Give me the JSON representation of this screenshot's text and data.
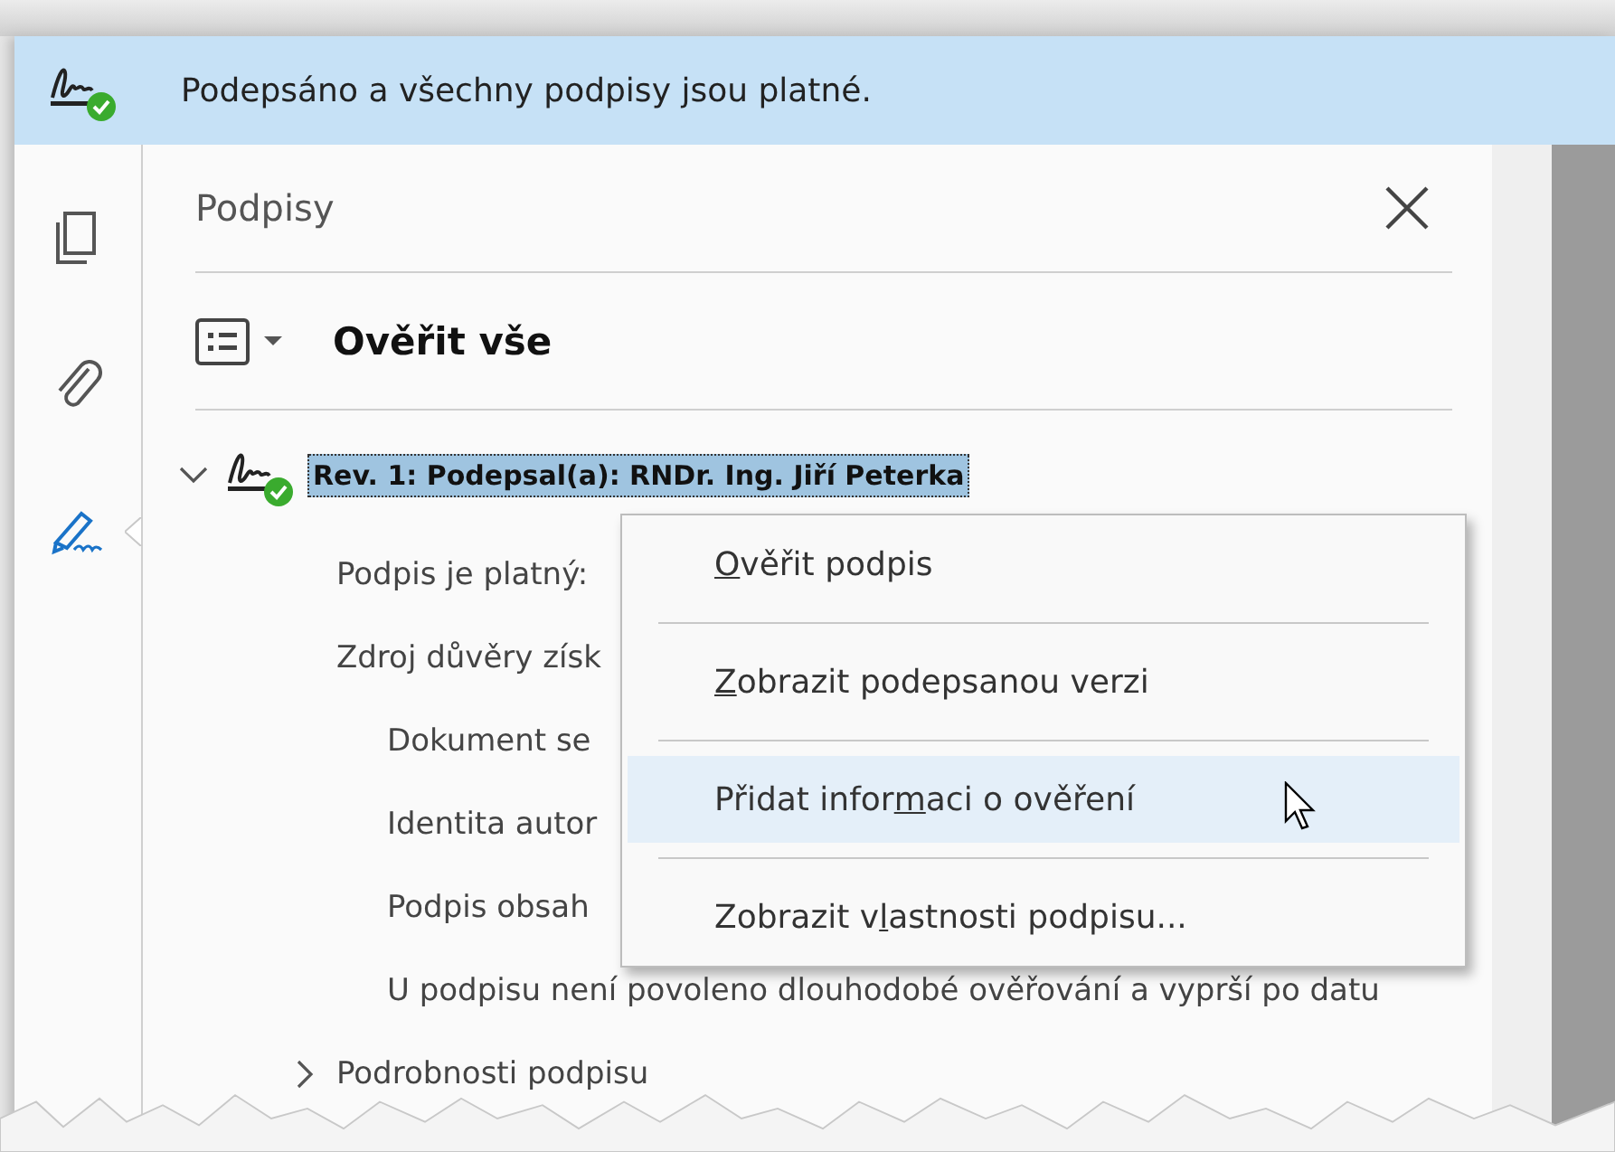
{
  "banner": {
    "text": "Podepsáno a všechny podpisy jsou platné."
  },
  "sidebar": {
    "items": [
      {
        "kind": "pages",
        "selected": false
      },
      {
        "kind": "attachments",
        "selected": false
      },
      {
        "kind": "signatures",
        "selected": true
      }
    ]
  },
  "panel": {
    "title": "Podpisy",
    "toolbar": {
      "label": "Ověřit vše"
    },
    "tree": [
      {
        "label": "Rev. 1: Podepsal(a): RNDr. Ing. Jiří Peterka",
        "expanded": true,
        "selected": true,
        "children": [
          {
            "label": "Podpis je platný:"
          },
          {
            "label": "Zdroj důvěry získ",
            "children": [
              {
                "label": "Dokument se"
              },
              {
                "label": "Identita autor"
              },
              {
                "label": "Podpis obsah"
              },
              {
                "label": "U podpisu není povoleno dlouhodobé ověřování a vyprší po datu"
              }
            ]
          },
          {
            "label": "Podrobnosti podpisu",
            "expanded": false
          }
        ]
      }
    ]
  },
  "context_menu": {
    "items": [
      {
        "key": "O",
        "after": "věřit podpis",
        "selected": false
      },
      {
        "key": "Z",
        "after": "obrazit podepsanou verzi",
        "selected": false
      },
      {
        "before": "Přidat infor",
        "key": "m",
        "after": "aci o ověření",
        "selected": true
      },
      {
        "before": "Zobrazit v",
        "key": "l",
        "after": "astnosti podpisu...",
        "selected": false
      }
    ]
  }
}
